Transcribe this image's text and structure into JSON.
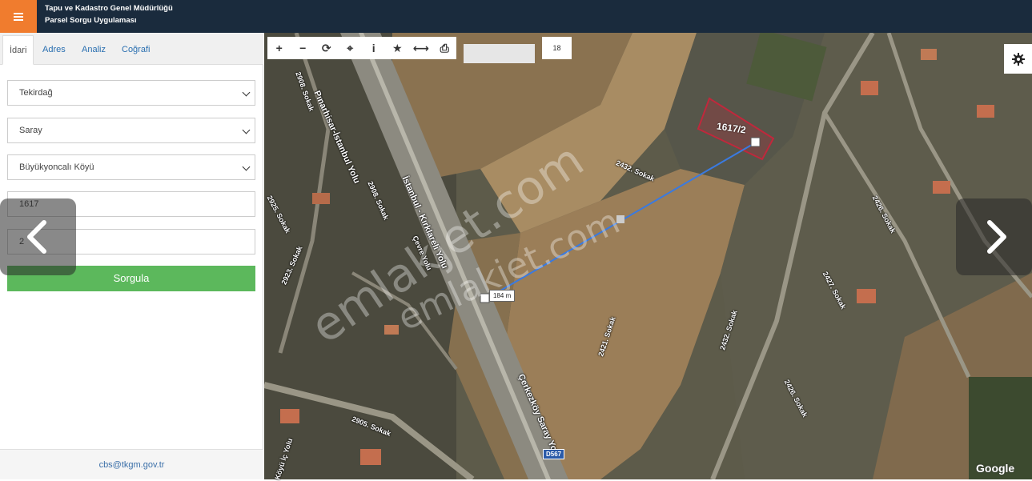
{
  "header": {
    "title_line1": "Tapu ve Kadastro Genel Müdürlüğü",
    "title_line2": "Parsel Sorgu Uygulaması",
    "menu_icon": "hamburger-icon"
  },
  "sidebar": {
    "tabs": [
      {
        "label": "İdari",
        "active": true
      },
      {
        "label": "Adres",
        "active": false
      },
      {
        "label": "Analiz",
        "active": false
      },
      {
        "label": "Coğrafi",
        "active": false
      }
    ],
    "fields": {
      "il": "Tekirdağ",
      "ilce": "Saray",
      "mahalle": "Büyükyoncalı Köyü",
      "ada": "1617",
      "parsel": "2"
    },
    "query_button": "Sorgula",
    "footer_email": "cbs@tkgm.gov.tr"
  },
  "map": {
    "toolbar_icons": [
      "plus-icon",
      "minus-icon",
      "refresh-icon",
      "crosshair-icon",
      "info-icon",
      "star-icon",
      "measure-icon",
      "print-icon"
    ],
    "toolbar_glyphs": [
      "+",
      "−",
      "⟳",
      "⌖",
      "i",
      "★",
      "⟷",
      "⎙"
    ],
    "zoom_level": "18",
    "parcel_label": "1617/2",
    "measure_label": "184 m",
    "road_labels": {
      "pinarhisar": "Pınarhisar-İstanbul Yolu",
      "istanbul_kirklareli": "İstanbul - Kırklareli Yolu",
      "cerkezkoy": "Çerkezköy Saray Yolu",
      "cevre": "Çevre Yolu",
      "s2432a": "2432. Sokak",
      "s2421": "2421. Sokak",
      "s2432b": "2432. Sokak",
      "s2426a": "2426. Sokak",
      "s2426b": "2426. Sokak",
      "s2427": "2427. Sokak",
      "s2905": "2905. Sokak",
      "s2908a": "2908. Sokak",
      "s2908b": "2908. Sokak",
      "s2923": "2923. Sokak",
      "s2925": "2925. Sokak",
      "koyu_ic": "Köyü İç Yolu"
    },
    "route_sign": "D567",
    "attribution": "Google",
    "watermark": "emlakjet.com"
  },
  "colors": {
    "header_bg": "#1a2b3d",
    "menu_accent": "#f07c2e",
    "query_button": "#5cb85c",
    "link": "#2a6fb0",
    "parcel_outline": "#c0283c",
    "measure_line": "#3a7ae0"
  }
}
